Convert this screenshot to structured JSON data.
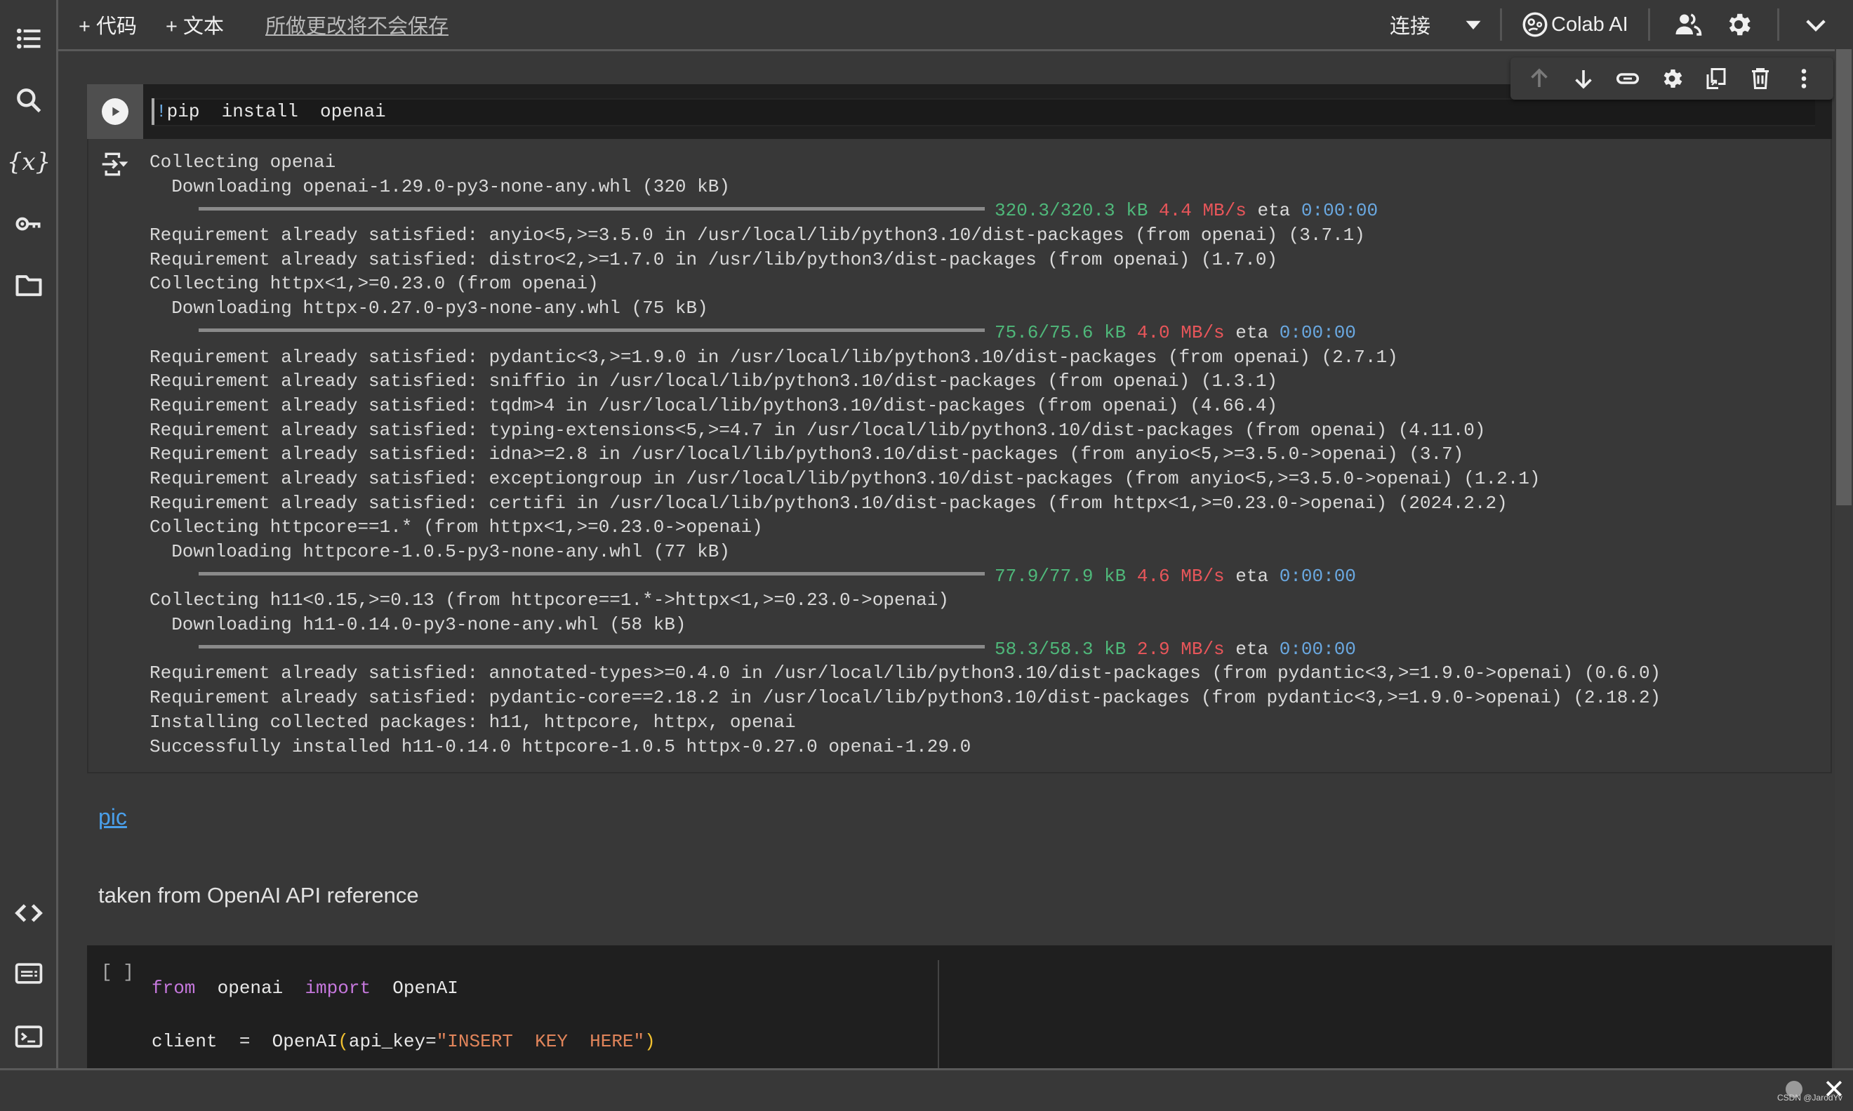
{
  "toolbar": {
    "add_code": "+ 代码",
    "add_text": "+ 文本",
    "unsaved_notice": "所做更改将不会保存",
    "connect": "连接",
    "colab_ai": "Colab AI"
  },
  "sidebar": {
    "top_icons": [
      "table-of-contents-icon",
      "search-icon",
      "variables-icon",
      "secrets-key-icon",
      "files-folder-icon"
    ],
    "bottom_icons": [
      "code-snippets-icon",
      "command-palette-icon",
      "terminal-icon"
    ]
  },
  "cell_toolbar": [
    "move-up-icon",
    "move-down-icon",
    "link-icon",
    "settings-icon",
    "mirror-cell-icon",
    "delete-icon",
    "more-options-icon"
  ],
  "cell1": {
    "code_bang": "!",
    "code_rest": "pip  install  openai",
    "output": [
      {
        "text": "Collecting openai"
      },
      {
        "text": "  Downloading openai-1.29.0-py3-none-any.whl (320 kB)"
      },
      {
        "progress": 1.0,
        "size": "320.3/320.3 kB",
        "speed": "4.4 MB/s",
        "eta_label": "eta",
        "eta": "0:00:00"
      },
      {
        "text": "Requirement already satisfied: anyio<5,>=3.5.0 in /usr/local/lib/python3.10/dist-packages (from openai) (3.7.1)"
      },
      {
        "text": "Requirement already satisfied: distro<2,>=1.7.0 in /usr/lib/python3/dist-packages (from openai) (1.7.0)"
      },
      {
        "text": "Collecting httpx<1,>=0.23.0 (from openai)"
      },
      {
        "text": "  Downloading httpx-0.27.0-py3-none-any.whl (75 kB)"
      },
      {
        "progress": 1.0,
        "size": "75.6/75.6 kB",
        "speed": "4.0 MB/s",
        "eta_label": "eta",
        "eta": "0:00:00"
      },
      {
        "text": "Requirement already satisfied: pydantic<3,>=1.9.0 in /usr/local/lib/python3.10/dist-packages (from openai) (2.7.1)"
      },
      {
        "text": "Requirement already satisfied: sniffio in /usr/local/lib/python3.10/dist-packages (from openai) (1.3.1)"
      },
      {
        "text": "Requirement already satisfied: tqdm>4 in /usr/local/lib/python3.10/dist-packages (from openai) (4.66.4)"
      },
      {
        "text": "Requirement already satisfied: typing-extensions<5,>=4.7 in /usr/local/lib/python3.10/dist-packages (from openai) (4.11.0)"
      },
      {
        "text": "Requirement already satisfied: idna>=2.8 in /usr/local/lib/python3.10/dist-packages (from anyio<5,>=3.5.0->openai) (3.7)"
      },
      {
        "text": "Requirement already satisfied: exceptiongroup in /usr/local/lib/python3.10/dist-packages (from anyio<5,>=3.5.0->openai) (1.2.1)"
      },
      {
        "text": "Requirement already satisfied: certifi in /usr/local/lib/python3.10/dist-packages (from httpx<1,>=0.23.0->openai) (2024.2.2)"
      },
      {
        "text": "Collecting httpcore==1.* (from httpx<1,>=0.23.0->openai)"
      },
      {
        "text": "  Downloading httpcore-1.0.5-py3-none-any.whl (77 kB)"
      },
      {
        "progress": 1.0,
        "size": "77.9/77.9 kB",
        "speed": "4.6 MB/s",
        "eta_label": "eta",
        "eta": "0:00:00"
      },
      {
        "text": "Collecting h11<0.15,>=0.13 (from httpcore==1.*->httpx<1,>=0.23.0->openai)"
      },
      {
        "text": "  Downloading h11-0.14.0-py3-none-any.whl (58 kB)"
      },
      {
        "progress": 1.0,
        "size": "58.3/58.3 kB",
        "speed": "2.9 MB/s",
        "eta_label": "eta",
        "eta": "0:00:00"
      },
      {
        "text": "Requirement already satisfied: annotated-types>=0.4.0 in /usr/local/lib/python3.10/dist-packages (from pydantic<3,>=1.9.0->openai) (0.6.0)"
      },
      {
        "text": "Requirement already satisfied: pydantic-core==2.18.2 in /usr/local/lib/python3.10/dist-packages (from pydantic<3,>=1.9.0->openai) (2.18.2)"
      },
      {
        "text": "Installing collected packages: h11, httpcore, httpx, openai"
      },
      {
        "text": "Successfully installed h11-0.14.0 httpcore-1.0.5 httpx-0.27.0 openai-1.29.0"
      }
    ]
  },
  "markdown": {
    "link_text": "pic",
    "text": "taken from OpenAI API reference"
  },
  "cell2": {
    "bracket": "[ ]",
    "line1": {
      "kw1": "from",
      "mod": "  openai  ",
      "kw2": "import",
      "name": "  OpenAI"
    },
    "line2": {
      "pre": "client  =  OpenAI",
      "open": "(",
      "arg": "api_key=",
      "str": "\"INSERT  KEY  HERE\"",
      "close": ")"
    }
  },
  "footer": {
    "watermark": "CSDN @JarodYv",
    "close": "✕"
  }
}
